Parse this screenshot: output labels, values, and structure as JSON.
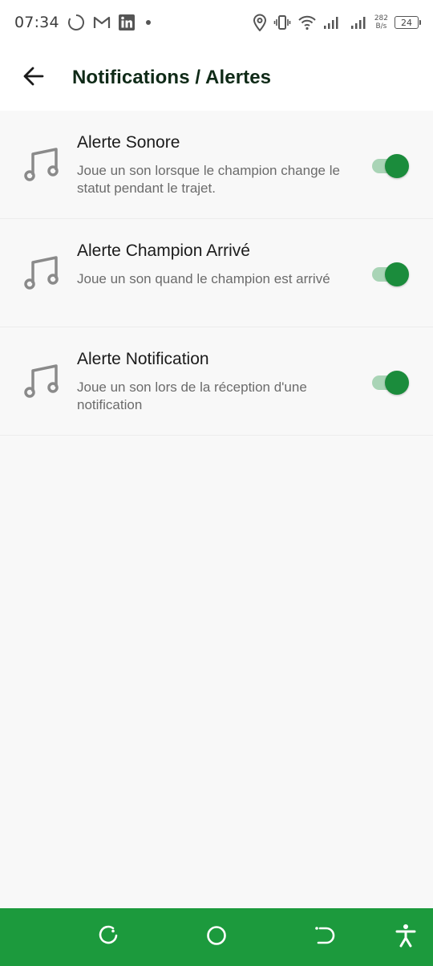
{
  "status_bar": {
    "time": "07:34",
    "net_speed_value": "282",
    "net_speed_unit": "B/s",
    "battery": "24"
  },
  "app_bar": {
    "title": "Notifications / Alertes"
  },
  "settings": [
    {
      "title": "Alerte Sonore",
      "description": "Joue un son lorsque le champion change le statut pendant le trajet.",
      "enabled": true
    },
    {
      "title": "Alerte Champion Arrivé",
      "description": "Joue un son quand le champion est arrivé",
      "enabled": true
    },
    {
      "title": "Alerte Notification",
      "description": "Joue un son lors de la réception d'une notification",
      "enabled": true
    }
  ],
  "colors": {
    "accent": "#1b8c3c",
    "nav_bar": "#1c9a3d",
    "title_text": "#0f2a17"
  },
  "icons": {
    "back": "arrow-left-icon",
    "row": "music-note-icon",
    "nav": [
      "recents-icon",
      "home-icon",
      "back-icon",
      "accessibility-icon"
    ]
  }
}
